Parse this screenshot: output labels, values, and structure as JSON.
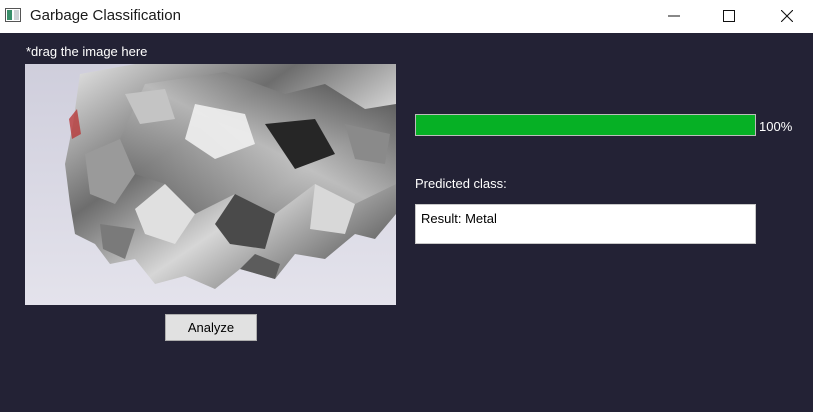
{
  "window": {
    "title": "Garbage Classification",
    "icon": "app-window-icon",
    "controls": [
      "minimize-icon",
      "maximize-icon",
      "close-icon"
    ]
  },
  "drop_area": {
    "hint": "*drag the image here",
    "image": "crumpled aluminum foil photo"
  },
  "analyze_button": {
    "label": "Analyze"
  },
  "progress": {
    "value_percent": 100,
    "label": "100%",
    "color": "#06b025"
  },
  "prediction": {
    "label": "Predicted class:",
    "result": "Result: Metal"
  },
  "colors": {
    "background": "#232235",
    "titlebar": "#ffffff"
  }
}
